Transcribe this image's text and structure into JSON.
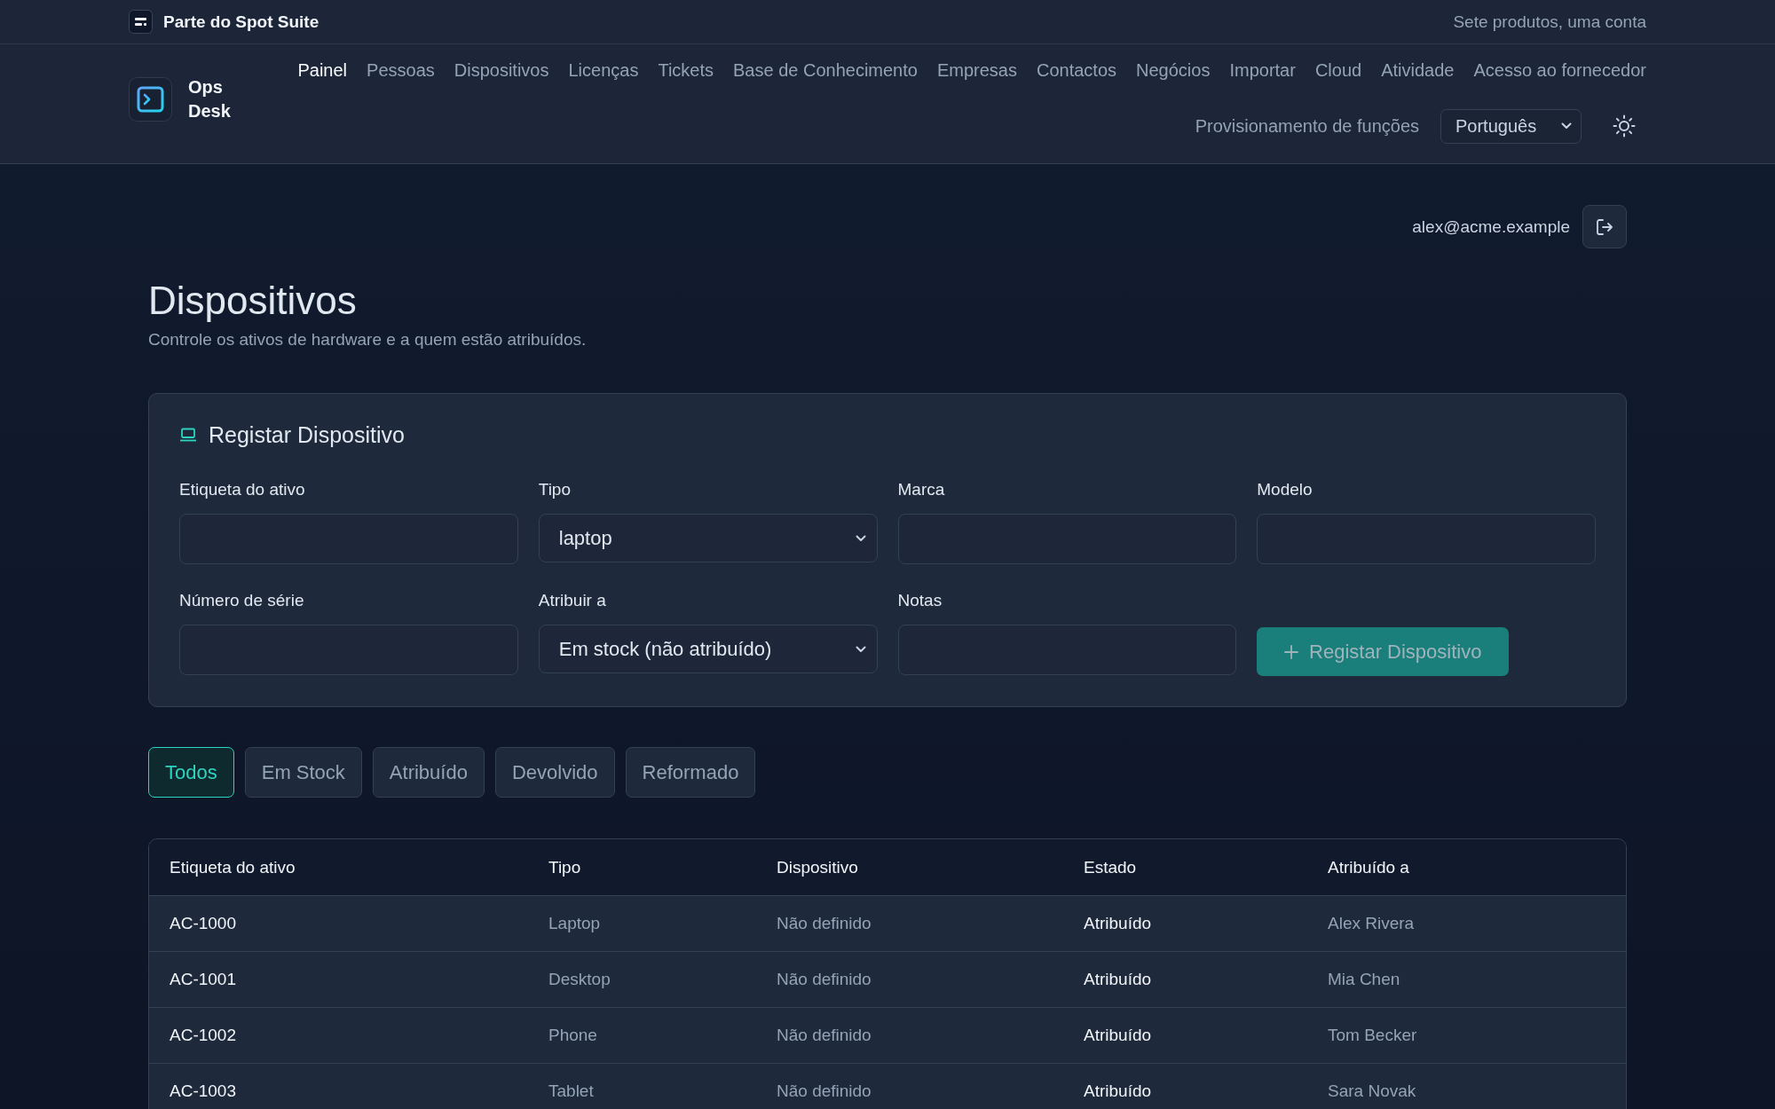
{
  "suite_bar": {
    "title": "Parte do Spot Suite",
    "tagline": "Sete produtos, uma conta"
  },
  "header": {
    "brand": "Ops Desk",
    "nav": [
      {
        "label": "Painel",
        "selected": true
      },
      {
        "label": "Pessoas",
        "selected": false
      },
      {
        "label": "Dispositivos",
        "selected": false
      },
      {
        "label": "Licenças",
        "selected": false
      },
      {
        "label": "Tickets",
        "selected": false
      },
      {
        "label": "Base de Conhecimento",
        "selected": false
      },
      {
        "label": "Empresas",
        "selected": false
      },
      {
        "label": "Contactos",
        "selected": false
      },
      {
        "label": "Negócios",
        "selected": false
      },
      {
        "label": "Importar",
        "selected": false
      },
      {
        "label": "Cloud",
        "selected": false
      },
      {
        "label": "Atividade",
        "selected": false
      },
      {
        "label": "Acesso ao fornecedor",
        "selected": false
      }
    ],
    "role_provisioning": "Provisionamento de funções",
    "language_select": {
      "value": "Português"
    }
  },
  "user": {
    "email": "alex@acme.example"
  },
  "page": {
    "title": "Dispositivos",
    "subtitle": "Controle os ativos de hardware e a quem estão atribuídos."
  },
  "register_form": {
    "title": "Registar Dispositivo",
    "fields": [
      {
        "kind": "input",
        "label": "Etiqueta do ativo"
      },
      {
        "kind": "select",
        "label": "Tipo",
        "value": "laptop"
      },
      {
        "kind": "input",
        "label": "Marca"
      },
      {
        "kind": "input",
        "label": "Modelo"
      },
      {
        "kind": "input",
        "label": "Número de série"
      },
      {
        "kind": "select",
        "label": "Atribuir a",
        "value": "Em stock (não atribuído)"
      },
      {
        "kind": "input",
        "label": "Notas"
      }
    ],
    "submit": {
      "label": "Registar Dispositivo",
      "disabled": true
    }
  },
  "filters": [
    {
      "label": "Todos",
      "selected": true
    },
    {
      "label": "Em Stock",
      "selected": false
    },
    {
      "label": "Atribuído",
      "selected": false
    },
    {
      "label": "Devolvido",
      "selected": false
    },
    {
      "label": "Reformado",
      "selected": false
    }
  ],
  "table": {
    "columns": [
      "Etiqueta do ativo",
      "Tipo",
      "Dispositivo",
      "Estado",
      "Atribuído a"
    ],
    "rows": [
      {
        "cells": [
          "AC-1000",
          "Laptop",
          "Não definido",
          "Atribuído",
          "Alex Rivera"
        ]
      },
      {
        "cells": [
          "AC-1001",
          "Desktop",
          "Não definido",
          "Atribuído",
          "Mia Chen"
        ]
      },
      {
        "cells": [
          "AC-1002",
          "Phone",
          "Não definido",
          "Atribuído",
          "Tom Becker"
        ]
      },
      {
        "cells": [
          "AC-1003",
          "Tablet",
          "Não definido",
          "Atribuído",
          "Sara Novak"
        ]
      }
    ]
  }
}
